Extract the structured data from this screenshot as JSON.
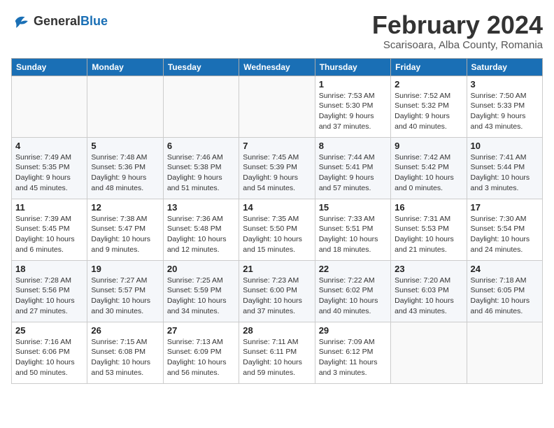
{
  "logo": {
    "general": "General",
    "blue": "Blue"
  },
  "header": {
    "month_title": "February 2024",
    "location": "Scarisoara, Alba County, Romania"
  },
  "weekdays": [
    "Sunday",
    "Monday",
    "Tuesday",
    "Wednesday",
    "Thursday",
    "Friday",
    "Saturday"
  ],
  "weeks": [
    [
      {
        "day": "",
        "info": ""
      },
      {
        "day": "",
        "info": ""
      },
      {
        "day": "",
        "info": ""
      },
      {
        "day": "",
        "info": ""
      },
      {
        "day": "1",
        "info": "Sunrise: 7:53 AM\nSunset: 5:30 PM\nDaylight: 9 hours\nand 37 minutes."
      },
      {
        "day": "2",
        "info": "Sunrise: 7:52 AM\nSunset: 5:32 PM\nDaylight: 9 hours\nand 40 minutes."
      },
      {
        "day": "3",
        "info": "Sunrise: 7:50 AM\nSunset: 5:33 PM\nDaylight: 9 hours\nand 43 minutes."
      }
    ],
    [
      {
        "day": "4",
        "info": "Sunrise: 7:49 AM\nSunset: 5:35 PM\nDaylight: 9 hours\nand 45 minutes."
      },
      {
        "day": "5",
        "info": "Sunrise: 7:48 AM\nSunset: 5:36 PM\nDaylight: 9 hours\nand 48 minutes."
      },
      {
        "day": "6",
        "info": "Sunrise: 7:46 AM\nSunset: 5:38 PM\nDaylight: 9 hours\nand 51 minutes."
      },
      {
        "day": "7",
        "info": "Sunrise: 7:45 AM\nSunset: 5:39 PM\nDaylight: 9 hours\nand 54 minutes."
      },
      {
        "day": "8",
        "info": "Sunrise: 7:44 AM\nSunset: 5:41 PM\nDaylight: 9 hours\nand 57 minutes."
      },
      {
        "day": "9",
        "info": "Sunrise: 7:42 AM\nSunset: 5:42 PM\nDaylight: 10 hours\nand 0 minutes."
      },
      {
        "day": "10",
        "info": "Sunrise: 7:41 AM\nSunset: 5:44 PM\nDaylight: 10 hours\nand 3 minutes."
      }
    ],
    [
      {
        "day": "11",
        "info": "Sunrise: 7:39 AM\nSunset: 5:45 PM\nDaylight: 10 hours\nand 6 minutes."
      },
      {
        "day": "12",
        "info": "Sunrise: 7:38 AM\nSunset: 5:47 PM\nDaylight: 10 hours\nand 9 minutes."
      },
      {
        "day": "13",
        "info": "Sunrise: 7:36 AM\nSunset: 5:48 PM\nDaylight: 10 hours\nand 12 minutes."
      },
      {
        "day": "14",
        "info": "Sunrise: 7:35 AM\nSunset: 5:50 PM\nDaylight: 10 hours\nand 15 minutes."
      },
      {
        "day": "15",
        "info": "Sunrise: 7:33 AM\nSunset: 5:51 PM\nDaylight: 10 hours\nand 18 minutes."
      },
      {
        "day": "16",
        "info": "Sunrise: 7:31 AM\nSunset: 5:53 PM\nDaylight: 10 hours\nand 21 minutes."
      },
      {
        "day": "17",
        "info": "Sunrise: 7:30 AM\nSunset: 5:54 PM\nDaylight: 10 hours\nand 24 minutes."
      }
    ],
    [
      {
        "day": "18",
        "info": "Sunrise: 7:28 AM\nSunset: 5:56 PM\nDaylight: 10 hours\nand 27 minutes."
      },
      {
        "day": "19",
        "info": "Sunrise: 7:27 AM\nSunset: 5:57 PM\nDaylight: 10 hours\nand 30 minutes."
      },
      {
        "day": "20",
        "info": "Sunrise: 7:25 AM\nSunset: 5:59 PM\nDaylight: 10 hours\nand 34 minutes."
      },
      {
        "day": "21",
        "info": "Sunrise: 7:23 AM\nSunset: 6:00 PM\nDaylight: 10 hours\nand 37 minutes."
      },
      {
        "day": "22",
        "info": "Sunrise: 7:22 AM\nSunset: 6:02 PM\nDaylight: 10 hours\nand 40 minutes."
      },
      {
        "day": "23",
        "info": "Sunrise: 7:20 AM\nSunset: 6:03 PM\nDaylight: 10 hours\nand 43 minutes."
      },
      {
        "day": "24",
        "info": "Sunrise: 7:18 AM\nSunset: 6:05 PM\nDaylight: 10 hours\nand 46 minutes."
      }
    ],
    [
      {
        "day": "25",
        "info": "Sunrise: 7:16 AM\nSunset: 6:06 PM\nDaylight: 10 hours\nand 50 minutes."
      },
      {
        "day": "26",
        "info": "Sunrise: 7:15 AM\nSunset: 6:08 PM\nDaylight: 10 hours\nand 53 minutes."
      },
      {
        "day": "27",
        "info": "Sunrise: 7:13 AM\nSunset: 6:09 PM\nDaylight: 10 hours\nand 56 minutes."
      },
      {
        "day": "28",
        "info": "Sunrise: 7:11 AM\nSunset: 6:11 PM\nDaylight: 10 hours\nand 59 minutes."
      },
      {
        "day": "29",
        "info": "Sunrise: 7:09 AM\nSunset: 6:12 PM\nDaylight: 11 hours\nand 3 minutes."
      },
      {
        "day": "",
        "info": ""
      },
      {
        "day": "",
        "info": ""
      }
    ]
  ]
}
